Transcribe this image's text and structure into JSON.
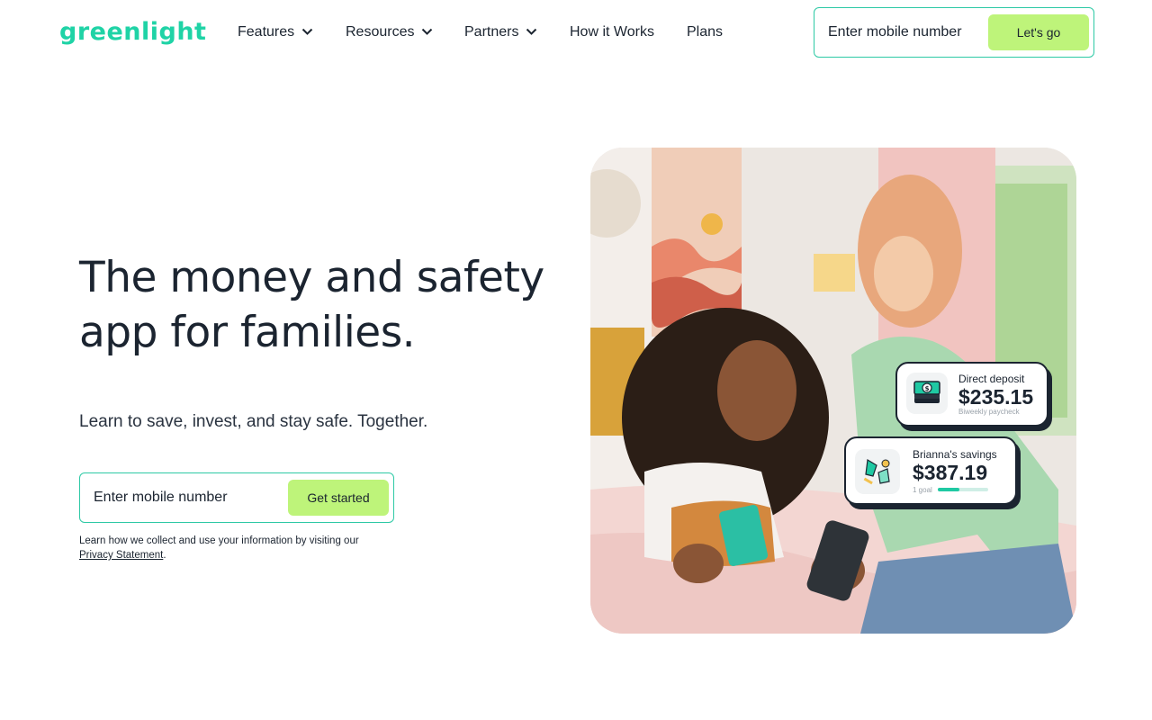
{
  "header": {
    "logo": "greenlight",
    "nav": [
      {
        "label": "Features",
        "dropdown": true
      },
      {
        "label": "Resources",
        "dropdown": true
      },
      {
        "label": "Partners",
        "dropdown": true
      },
      {
        "label": "How it Works",
        "dropdown": false
      },
      {
        "label": "Plans",
        "dropdown": false
      }
    ],
    "signup": {
      "placeholder": "Enter mobile number",
      "button": "Let's go"
    }
  },
  "hero": {
    "headline_line1": "The money and safety",
    "headline_line2": "app for families.",
    "subline": "Learn to save, invest, and stay safe. Together.",
    "signup": {
      "placeholder": "Enter mobile number",
      "button": "Get started"
    },
    "privacy_text": "Learn how we collect and use your information by visiting our",
    "privacy_link": "Privacy Statement",
    "privacy_end": "."
  },
  "overlay_cards": {
    "deposit": {
      "icon": "cash-stack-icon",
      "label": "Direct deposit",
      "amount": "$235.15",
      "caption": "Biweekly paycheck"
    },
    "savings": {
      "icon": "savings-goal-icon",
      "label": "Brianna's savings",
      "amount": "$387.19",
      "caption": "1 goal",
      "progress": 0.42
    }
  },
  "colors": {
    "brand": "#1fd3a6",
    "button": "#bef47a",
    "border": "#2dc9a5",
    "text": "#1b2430"
  }
}
